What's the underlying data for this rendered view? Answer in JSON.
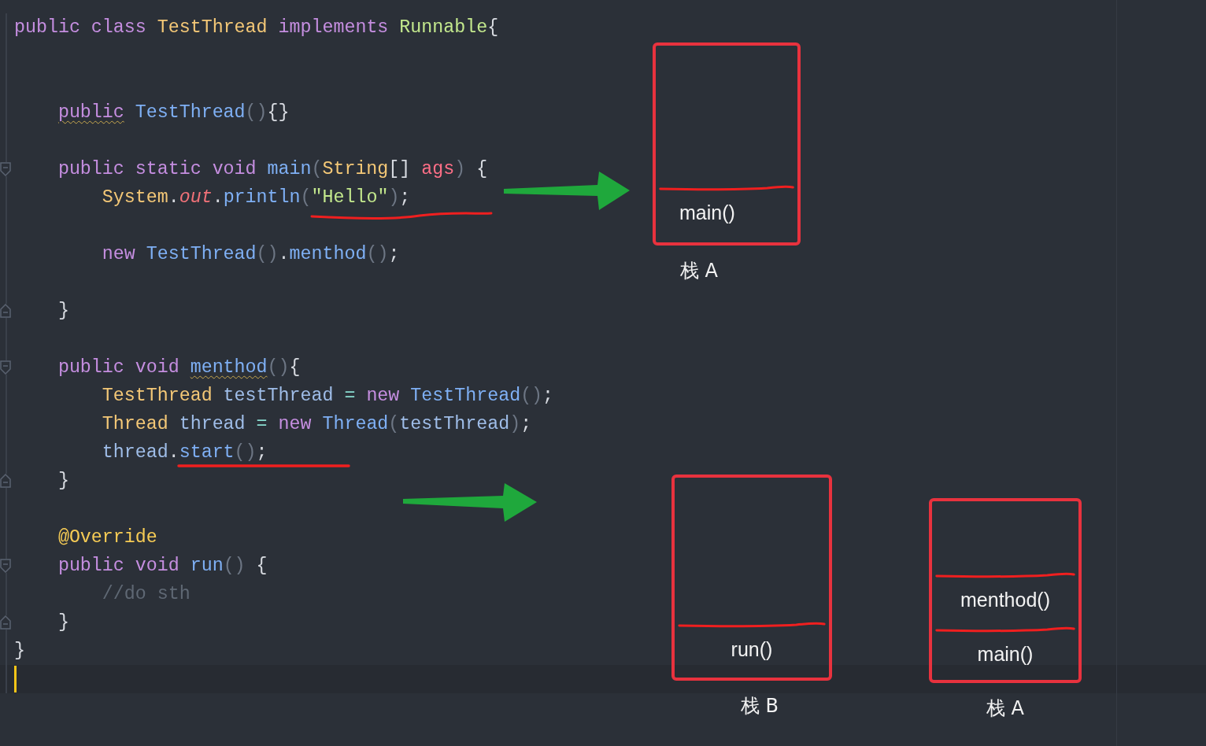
{
  "editor": {
    "lines": [
      {
        "kind": "code",
        "tokens": [
          {
            "text": "public class",
            "kind": "keyword"
          },
          {
            "text": " TestThread",
            "kind": "type"
          },
          {
            "text": " implements",
            "kind": "keyword"
          },
          {
            "text": " Runnable",
            "kind": "iface"
          },
          {
            "text": "{",
            "kind": "brace"
          }
        ],
        "children": [
          {
            "kind": "blank"
          },
          {
            "kind": "blank"
          },
          {
            "kind": "code",
            "tokens": [
              {
                "text": "public",
                "kind": "keyword",
                "squiggly": true
              },
              {
                "text": " TestThread",
                "kind": "method"
              },
              {
                "text": "()",
                "kind": "paren"
              },
              {
                "text": "{}",
                "kind": "brace"
              }
            ]
          },
          {
            "kind": "blank"
          },
          {
            "kind": "code",
            "fold_open": true,
            "tokens": [
              {
                "text": "public static void",
                "kind": "keyword"
              },
              {
                "text": " main",
                "kind": "method"
              },
              {
                "text": "(",
                "kind": "paren"
              },
              {
                "text": "String",
                "kind": "type"
              },
              {
                "text": "[]",
                "kind": "brace"
              },
              {
                "text": " ags",
                "kind": "param"
              },
              {
                "text": ")",
                "kind": "paren"
              },
              {
                "text": " {",
                "kind": "brace"
              }
            ],
            "children": [
              {
                "kind": "code",
                "tokens": [
                  {
                    "text": "System",
                    "kind": "type"
                  },
                  {
                    "text": ".",
                    "kind": "brace"
                  },
                  {
                    "text": "out",
                    "kind": "field"
                  },
                  {
                    "text": ".",
                    "kind": "brace"
                  },
                  {
                    "text": "println",
                    "kind": "method"
                  },
                  {
                    "text": "(",
                    "kind": "paren"
                  },
                  {
                    "text": "\"Hello\"",
                    "kind": "string"
                  },
                  {
                    "text": ")",
                    "kind": "paren"
                  },
                  {
                    "text": ";",
                    "kind": "brace"
                  }
                ]
              },
              {
                "kind": "blank"
              },
              {
                "kind": "code",
                "tokens": [
                  {
                    "text": "new",
                    "kind": "keyword"
                  },
                  {
                    "text": " TestThread",
                    "kind": "method"
                  },
                  {
                    "text": "()",
                    "kind": "paren"
                  },
                  {
                    "text": ".",
                    "kind": "brace"
                  },
                  {
                    "text": "menthod",
                    "kind": "method"
                  },
                  {
                    "text": "()",
                    "kind": "paren"
                  },
                  {
                    "text": ";",
                    "kind": "brace"
                  }
                ]
              },
              {
                "kind": "blank"
              }
            ]
          },
          {
            "kind": "code",
            "fold_close": true,
            "tokens": [
              {
                "text": "}",
                "kind": "brace"
              }
            ]
          },
          {
            "kind": "blank"
          },
          {
            "kind": "code",
            "fold_open": true,
            "tokens": [
              {
                "text": "public void ",
                "kind": "keyword"
              },
              {
                "text": "menthod",
                "kind": "method",
                "squiggly": true
              },
              {
                "text": "()",
                "kind": "paren"
              },
              {
                "text": "{",
                "kind": "brace"
              }
            ],
            "children": [
              {
                "kind": "code",
                "tokens": [
                  {
                    "text": "TestThread",
                    "kind": "type"
                  },
                  {
                    "text": " testThread",
                    "kind": "var"
                  },
                  {
                    "text": " =",
                    "kind": "operator"
                  },
                  {
                    "text": " new",
                    "kind": "keyword"
                  },
                  {
                    "text": " TestThread",
                    "kind": "method"
                  },
                  {
                    "text": "()",
                    "kind": "paren"
                  },
                  {
                    "text": ";",
                    "kind": "brace"
                  }
                ]
              },
              {
                "kind": "code",
                "tokens": [
                  {
                    "text": "Thread",
                    "kind": "type"
                  },
                  {
                    "text": " thread",
                    "kind": "var"
                  },
                  {
                    "text": " =",
                    "kind": "operator"
                  },
                  {
                    "text": " new",
                    "kind": "keyword"
                  },
                  {
                    "text": " Thread",
                    "kind": "method"
                  },
                  {
                    "text": "(",
                    "kind": "paren"
                  },
                  {
                    "text": "testThread",
                    "kind": "var"
                  },
                  {
                    "text": ")",
                    "kind": "paren"
                  },
                  {
                    "text": ";",
                    "kind": "brace"
                  }
                ]
              },
              {
                "kind": "code",
                "tokens": [
                  {
                    "text": "thread",
                    "kind": "var"
                  },
                  {
                    "text": ".",
                    "kind": "brace"
                  },
                  {
                    "text": "start",
                    "kind": "method"
                  },
                  {
                    "text": "()",
                    "kind": "paren"
                  },
                  {
                    "text": ";",
                    "kind": "brace"
                  }
                ]
              }
            ]
          },
          {
            "kind": "code",
            "fold_close": true,
            "tokens": [
              {
                "text": "}",
                "kind": "brace"
              }
            ]
          },
          {
            "kind": "blank"
          },
          {
            "kind": "code",
            "tokens": [
              {
                "text": "@Override",
                "kind": "annotation"
              }
            ]
          },
          {
            "kind": "code",
            "fold_open": true,
            "tokens": [
              {
                "text": "public void",
                "kind": "keyword"
              },
              {
                "text": " run",
                "kind": "method"
              },
              {
                "text": "()",
                "kind": "paren"
              },
              {
                "text": " {",
                "kind": "brace"
              }
            ],
            "children": [
              {
                "kind": "code",
                "tokens": [
                  {
                    "text": "//do sth",
                    "kind": "comment"
                  }
                ]
              }
            ]
          },
          {
            "kind": "code",
            "fold_close": true,
            "tokens": [
              {
                "text": "}",
                "kind": "brace"
              }
            ]
          }
        ]
      },
      {
        "kind": "code",
        "tokens": [
          {
            "text": "}",
            "kind": "brace"
          }
        ]
      },
      {
        "kind": "caret"
      }
    ]
  },
  "diagram": {
    "stacks": [
      {
        "label": "栈 A",
        "frames": [
          "main()"
        ]
      },
      {
        "label": "栈 B",
        "frames": [
          "run()"
        ]
      },
      {
        "label": "栈 A",
        "frames": [
          "menthod()",
          "main()"
        ]
      }
    ]
  }
}
